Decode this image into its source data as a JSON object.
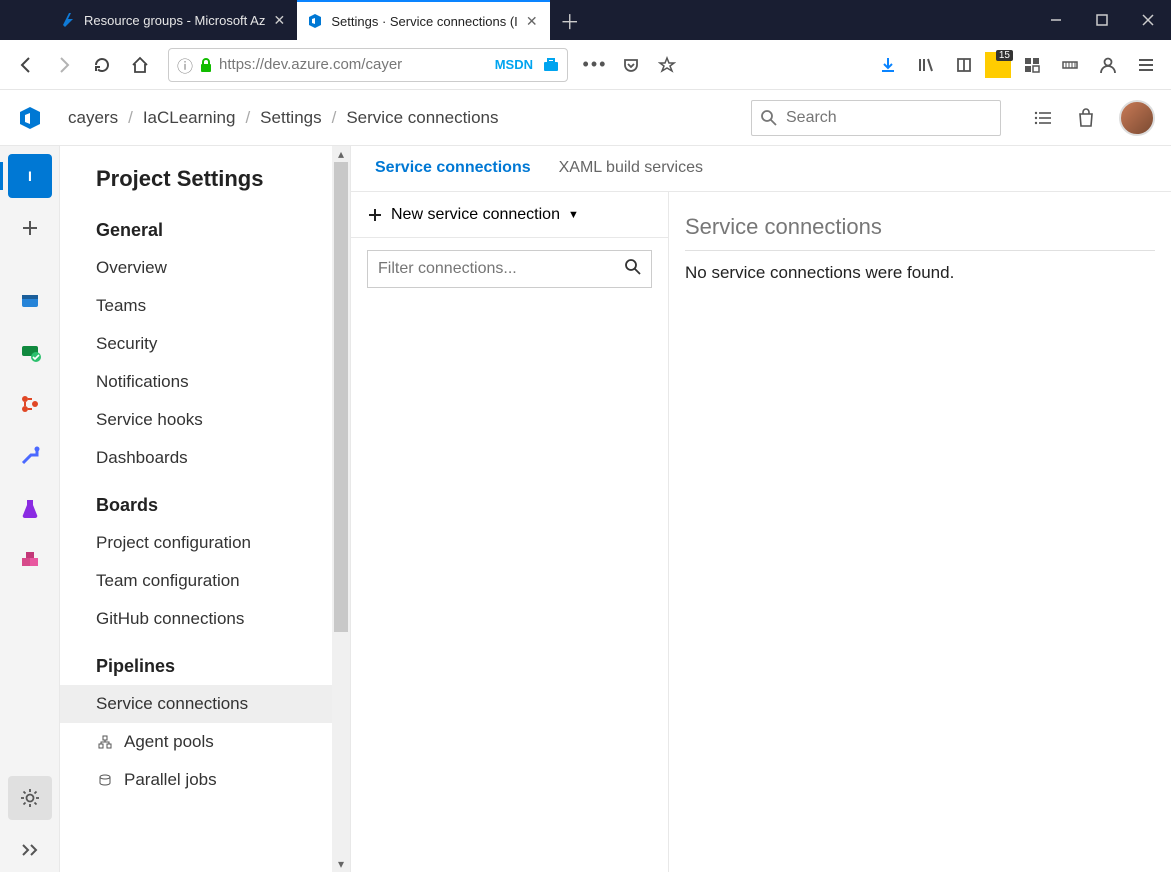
{
  "browser": {
    "tabs": [
      {
        "title": "Resource groups - Microsoft Az",
        "active": false
      },
      {
        "title": "Settings · Service connections (I",
        "active": true
      }
    ],
    "url": "https://dev.azure.com/cayer",
    "msdn_label": "MSDN",
    "toolbar_badge": "15"
  },
  "header": {
    "breadcrumbs": [
      "cayers",
      "IaCLearning",
      "Settings",
      "Service connections"
    ],
    "search_placeholder": "Search"
  },
  "sidebar": {
    "title": "Project Settings",
    "sections": [
      {
        "label": "General",
        "items": [
          "Overview",
          "Teams",
          "Security",
          "Notifications",
          "Service hooks",
          "Dashboards"
        ]
      },
      {
        "label": "Boards",
        "items": [
          "Project configuration",
          "Team configuration",
          "GitHub connections"
        ]
      },
      {
        "label": "Pipelines",
        "items": [
          "Service connections",
          "Agent pools",
          "Parallel jobs"
        ]
      }
    ],
    "active_item": "Service connections"
  },
  "content": {
    "tabs": [
      {
        "label": "Service connections",
        "active": true
      },
      {
        "label": "XAML build services",
        "active": false
      }
    ],
    "new_button": "New service connection",
    "filter_placeholder": "Filter connections...",
    "detail_title": "Service connections",
    "empty_message": "No service connections were found."
  }
}
